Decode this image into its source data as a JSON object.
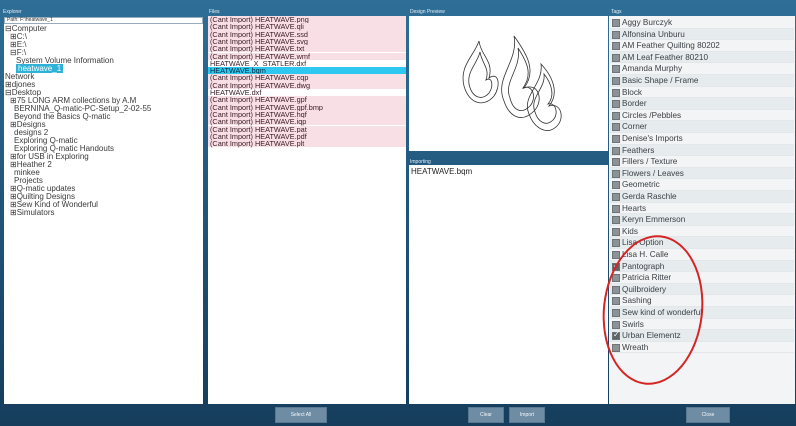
{
  "explorer": {
    "label": "Explorer",
    "path": "Path: F:\\heatwave_1",
    "items": [
      "⊟Computer",
      "⊞C:\\",
      "⊞E:\\",
      "⊟F:\\",
      "System Volume Information",
      "heatwave_1",
      "Network",
      "⊞djones",
      "⊟Desktop",
      "⊞75 LONG ARM collections by A.M",
      "BERNINA_Q-matic-PC-Setup_2-02-55",
      "Beyond the Basics Q-matic",
      "⊞Designs",
      "designs 2",
      "Exploring Q-matic",
      "Exploring Q-matic Handouts",
      "⊞for USB in Exploring",
      "⊞Heather 2",
      "minkee",
      "Projects",
      "⊞Q-matic updates",
      "⊞Quilting Designs",
      "⊞Sew Kind of Wonderful",
      "⊞Simulators"
    ]
  },
  "files": {
    "label": "Files",
    "items": [
      "(Cant Import) HEATWAVE.png",
      "(Cant Import) HEATWAVE.qli",
      "(Cant Import) HEATWAVE.ssd",
      "(Cant Import) HEATWAVE.svg",
      "(Cant Import) HEATWAVE.txt",
      "(Cant Import) HEATWAVE.wmf",
      "HEATWAVE_X_STATLER.dxf",
      "HEATWAVE.bqm",
      "(Cant Import) HEATWAVE.cqp",
      "(Cant Import) HEATWAVE.dwg",
      "HEATWAVE.dxf",
      "(Cant Import) HEATWAVE.gpf",
      "(Cant Import) HEATWAVE.gpf.bmp",
      "(Cant Import) HEATWAVE.hqf",
      "(Cant Import) HEATWAVE.iqp",
      "(Cant Import) HEATWAVE.pat",
      "(Cant Import) HEATWAVE.pdf",
      "(Cant Import) HEATWAVE.plt"
    ]
  },
  "preview": {
    "label": "Design Preview"
  },
  "importing": {
    "label": "Importing",
    "file": "HEATWAVE.bqm"
  },
  "tags": {
    "label": "Tags",
    "items": [
      {
        "label": "Aggy Burczyk",
        "checked": false
      },
      {
        "label": "Alfonsina Unburu",
        "checked": false
      },
      {
        "label": "AM Feather Quilting 80202",
        "checked": false
      },
      {
        "label": "AM Leaf Feather 80210",
        "checked": false
      },
      {
        "label": "Amanda Murphy",
        "checked": false
      },
      {
        "label": "Basic Shape / Frame",
        "checked": false
      },
      {
        "label": "Block",
        "checked": false
      },
      {
        "label": "Border",
        "checked": false
      },
      {
        "label": "Circles /Pebbles",
        "checked": false
      },
      {
        "label": "Corner",
        "checked": false
      },
      {
        "label": "Denise's Imports",
        "checked": false
      },
      {
        "label": "Feathers",
        "checked": false
      },
      {
        "label": "Fillers / Texture",
        "checked": false
      },
      {
        "label": "Flowers / Leaves",
        "checked": false
      },
      {
        "label": "Geometric",
        "checked": false
      },
      {
        "label": "Gerda Raschle",
        "checked": false
      },
      {
        "label": "Hearts",
        "checked": false
      },
      {
        "label": "Keryn Emmerson",
        "checked": false
      },
      {
        "label": "Kids",
        "checked": false
      },
      {
        "label": "Lisa Option",
        "checked": false
      },
      {
        "label": "Lisa H. Calle",
        "checked": false
      },
      {
        "label": "Pantograph",
        "checked": true
      },
      {
        "label": "Patricia Ritter",
        "checked": false
      },
      {
        "label": "Quilbroidery",
        "checked": false
      },
      {
        "label": "Sashing",
        "checked": false
      },
      {
        "label": "Sew kind of wonderful",
        "checked": false
      },
      {
        "label": "Swirls",
        "checked": false
      },
      {
        "label": "Urban Elementz",
        "checked": true
      },
      {
        "label": "Wreath",
        "checked": false
      }
    ]
  },
  "buttons": {
    "select_all": "Select All",
    "clear": "Clear",
    "import": "Import",
    "close": "Close"
  },
  "colors": {
    "background": "#1f4a6b",
    "selection": "#2ec7f0",
    "cant_import_row": "#f8dfe5",
    "annotation": "#d62424"
  }
}
